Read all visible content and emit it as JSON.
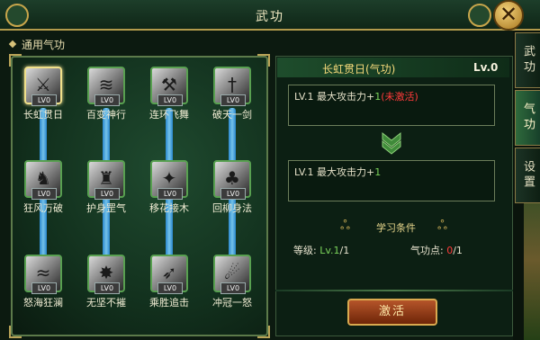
{
  "window": {
    "title": "武功",
    "close_glyph": "✕"
  },
  "side_tabs": [
    {
      "label": "武功",
      "active": false
    },
    {
      "label": "气功",
      "active": true
    },
    {
      "label": "设置",
      "active": false
    }
  ],
  "left": {
    "section_title": "通用气功",
    "skills": [
      {
        "name": "长虹贯日",
        "level": "LV0",
        "icon": "sword-slash-icon",
        "selected": true
      },
      {
        "name": "百变神行",
        "level": "LV0",
        "icon": "wind-icon"
      },
      {
        "name": "连环飞舞",
        "level": "LV0",
        "icon": "chain-blades-icon"
      },
      {
        "name": "破天一剑",
        "level": "LV0",
        "icon": "sky-sword-icon"
      },
      {
        "name": "狂风万破",
        "level": "LV0",
        "icon": "warrior-icon"
      },
      {
        "name": "护身罡气",
        "level": "LV0",
        "icon": "shield-warrior-icon"
      },
      {
        "name": "移花接木",
        "level": "LV0",
        "icon": "spark-icon"
      },
      {
        "name": "回柳身法",
        "level": "LV0",
        "icon": "willow-icon"
      },
      {
        "name": "怒海狂澜",
        "level": "LV0",
        "icon": "wave-icon"
      },
      {
        "name": "无坚不摧",
        "level": "LV0",
        "icon": "burst-icon"
      },
      {
        "name": "乘胜追击",
        "level": "LV0",
        "icon": "pursuit-icon"
      },
      {
        "name": "冲冠一怒",
        "level": "LV0",
        "icon": "rage-icon"
      }
    ]
  },
  "right": {
    "skill_title": "长虹贯日(气功)",
    "skill_level": "Lv.0",
    "current_effect": {
      "prefix": "LV.1 最大攻击力+",
      "value": "1",
      "status": "(未激活)"
    },
    "next_effect": {
      "prefix": "LV.1 最大攻击力+",
      "value": "1"
    },
    "requirements_title": "学习条件",
    "level_req": {
      "label": "等级:",
      "current": "Lv.1",
      "required": "/1"
    },
    "points_req": {
      "label": "气功点:",
      "current": "0",
      "required": "/1"
    },
    "activate_label": "激活"
  },
  "colors": {
    "accent_gold": "#d6c27a",
    "active_green": "#7bd45a",
    "inactive_red": "#ff3a3a"
  }
}
